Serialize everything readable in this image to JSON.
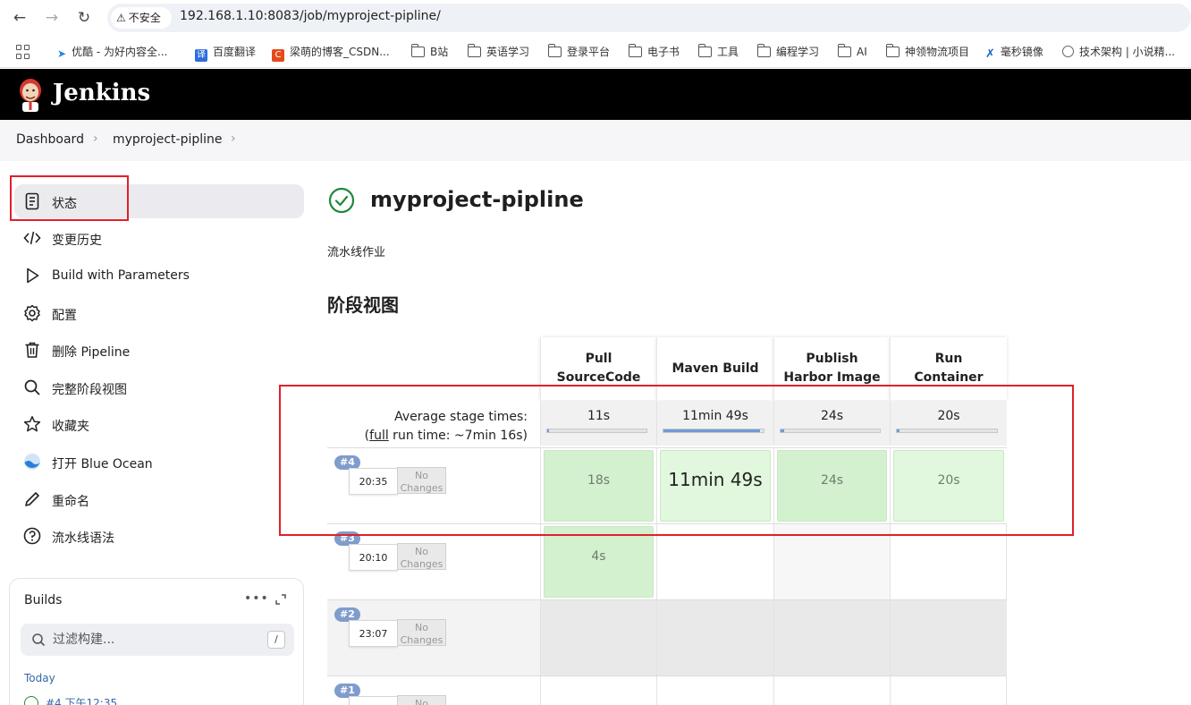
{
  "browser": {
    "security_label": "不安全",
    "url": "192.168.1.10:8083/job/myproject-pipline/",
    "bookmarks": [
      "优酷 - 为好内容全...",
      "百度翻译",
      "梁萌的博客_CSDN...",
      "B站",
      "英语学习",
      "登录平台",
      "电子书",
      "工具",
      "编程学习",
      "AI",
      "神领物流项目",
      "毫秒镜像",
      "技术架构 | 小说精..."
    ]
  },
  "header": {
    "title": "Jenkins"
  },
  "breadcrumb": [
    "Dashboard",
    "myproject-pipline"
  ],
  "sidebar": {
    "items": [
      {
        "label": "状态",
        "icon": "document-icon"
      },
      {
        "label": "变更历史",
        "icon": "code-icon"
      },
      {
        "label": "Build with Parameters",
        "icon": "play-icon"
      },
      {
        "label": "配置",
        "icon": "gear-icon"
      },
      {
        "label": "删除 Pipeline",
        "icon": "trash-icon"
      },
      {
        "label": "完整阶段视图",
        "icon": "search-icon"
      },
      {
        "label": "收藏夹",
        "icon": "star-icon"
      },
      {
        "label": "打开 Blue Ocean",
        "icon": "blue-ocean-icon"
      },
      {
        "label": "重命名",
        "icon": "pencil-icon"
      },
      {
        "label": "流水线语法",
        "icon": "help-icon"
      }
    ]
  },
  "builds": {
    "title": "Builds",
    "filter_placeholder": "过滤构建...",
    "shortcut": "/",
    "group": "Today",
    "first_item": "#4  下午12:35"
  },
  "job": {
    "title": "myproject-pipline",
    "description": "流水线作业",
    "stage_view_heading": "阶段视图"
  },
  "stage_view": {
    "stages": [
      {
        "name_line1": "Pull",
        "name_line2": "SourceCode",
        "avg": "11s",
        "avg_fraction": 0.02
      },
      {
        "name_line1": "Maven Build",
        "name_line2": "",
        "avg": "11min 49s",
        "avg_fraction": 0.96
      },
      {
        "name_line1": "Publish",
        "name_line2": "Harbor Image",
        "avg": "24s",
        "avg_fraction": 0.04
      },
      {
        "name_line1": "Run",
        "name_line2": "Container",
        "avg": "20s",
        "avg_fraction": 0.03
      }
    ],
    "avg_label_line1": "Average stage times:",
    "avg_label_full": "full",
    "avg_label_rest": " run time: ~7min 16s)",
    "no_changes_line1": "No",
    "no_changes_line2": "Changes",
    "runs": [
      {
        "number": "#4",
        "time": "20:35",
        "cells": [
          "18s",
          "11min 49s",
          "24s",
          "20s"
        ]
      },
      {
        "number": "#3",
        "time": "20:10",
        "cells": [
          "4s",
          "",
          "",
          ""
        ]
      },
      {
        "number": "#2",
        "time": "23:07",
        "cells": [
          "",
          "",
          "",
          ""
        ]
      },
      {
        "number": "#1",
        "time": "",
        "cells": [
          "",
          "",
          "",
          ""
        ]
      }
    ]
  }
}
